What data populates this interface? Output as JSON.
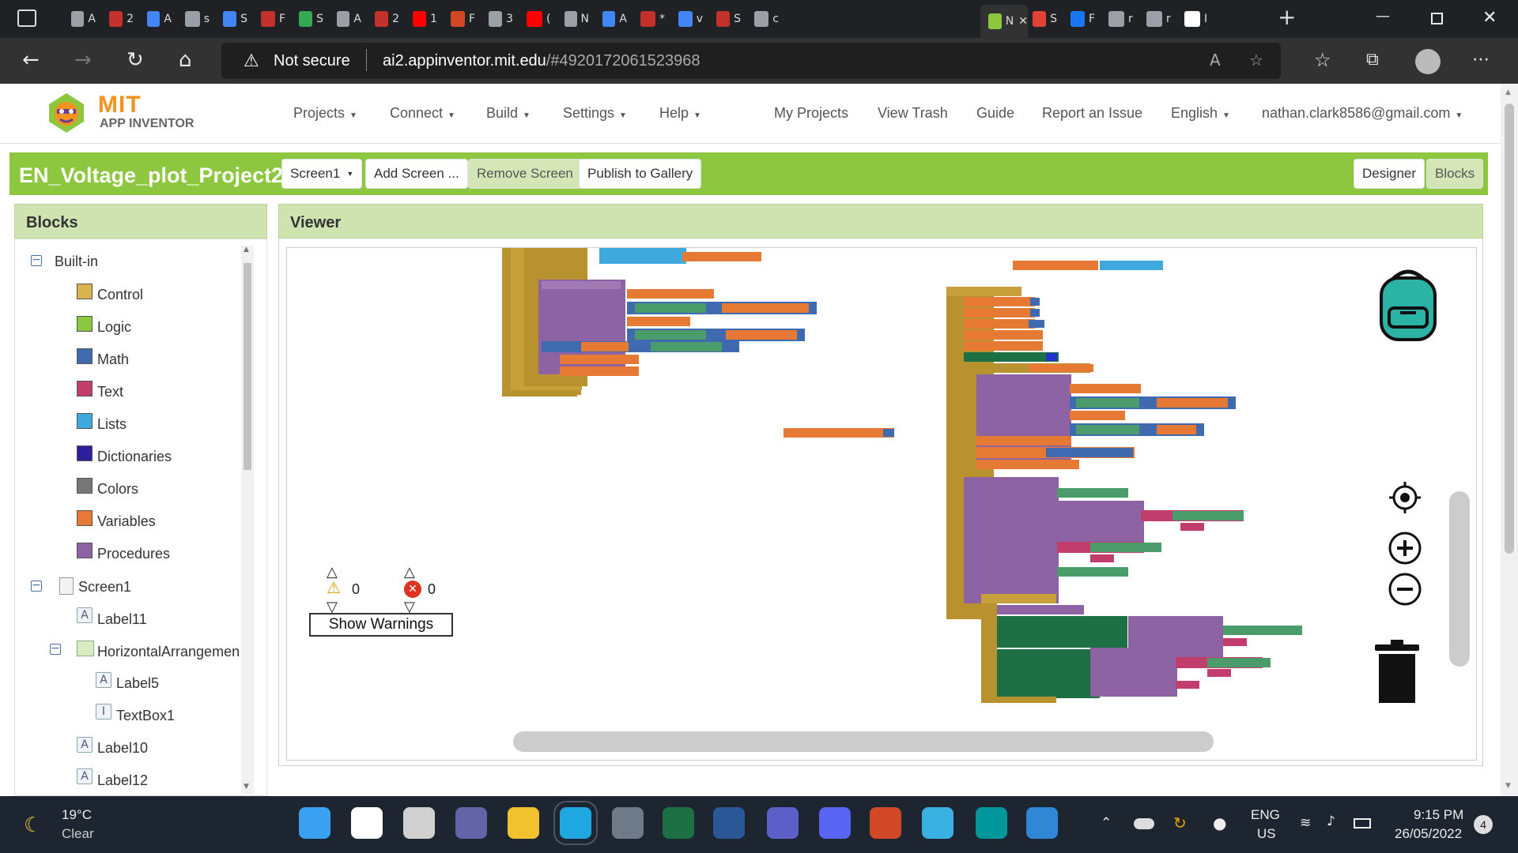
{
  "browser": {
    "tabs": [
      {
        "icon": "settings-icon",
        "color": "#9aa0a6",
        "title": "A"
      },
      {
        "icon": "pdf-icon",
        "color": "#c4312b",
        "title": "2"
      },
      {
        "icon": "docs-icon",
        "color": "#4285f4",
        "title": "A"
      },
      {
        "icon": "google-icon",
        "color": "#9aa0a6",
        "title": "s"
      },
      {
        "icon": "docs-icon",
        "color": "#4285f4",
        "title": "S"
      },
      {
        "icon": "pdf-icon",
        "color": "#c4312b",
        "title": "F"
      },
      {
        "icon": "drive-icon",
        "color": "#34a853",
        "title": "S"
      },
      {
        "icon": "file-icon",
        "color": "#9aa0a6",
        "title": "A"
      },
      {
        "icon": "pdf-icon",
        "color": "#c4312b",
        "title": "2"
      },
      {
        "icon": "youtube-icon",
        "color": "#ff0000",
        "title": "1"
      },
      {
        "icon": "powerpoint-icon",
        "color": "#d24726",
        "title": "F"
      },
      {
        "icon": "google-icon",
        "color": "#9aa0a6",
        "title": "3"
      },
      {
        "icon": "youtube-icon",
        "color": "#ff0000",
        "title": "("
      },
      {
        "icon": "window-icon",
        "color": "#9aa0a6",
        "title": "N"
      },
      {
        "icon": "docs-icon",
        "color": "#4285f4",
        "title": "A"
      },
      {
        "icon": "pdf-icon",
        "color": "#c4312b",
        "title": "*"
      },
      {
        "icon": "search-icon",
        "color": "#4285f4",
        "title": "v"
      },
      {
        "icon": "pdf-icon",
        "color": "#c4312b",
        "title": "S"
      },
      {
        "icon": "google-icon",
        "color": "#9aa0a6",
        "title": "c"
      },
      {
        "icon": "appinventor-icon",
        "color": "#8dc63f",
        "title": "N"
      },
      {
        "icon": "photo-icon",
        "color": "#e34133",
        "title": "S"
      },
      {
        "icon": "facebook-icon",
        "color": "#1877f2",
        "title": "F"
      },
      {
        "icon": "google-icon",
        "color": "#9aa0a6",
        "title": "r"
      },
      {
        "icon": "github-icon",
        "color": "#9aa0a6",
        "title": "r"
      },
      {
        "icon": "google-icon",
        "color": "#ffffff",
        "title": "I"
      }
    ],
    "not_secure": "Not secure",
    "url_domain": "ai2.appinventor.mit.edu",
    "url_rest": "/#4920172061523968"
  },
  "header": {
    "logo_line1": "MIT",
    "logo_line2": "APP INVENTOR",
    "menus": [
      "Projects",
      "Connect",
      "Build",
      "Settings",
      "Help"
    ],
    "links": [
      "My Projects",
      "View Trash",
      "Guide",
      "Report an Issue"
    ],
    "language": "English",
    "account": "nathan.clark8586@gmail.com"
  },
  "toolbar": {
    "project_name": "EN_Voltage_plot_Project2",
    "screen": "Screen1",
    "add_screen": "Add Screen ...",
    "remove_screen": "Remove Screen",
    "publish": "Publish to Gallery",
    "designer": "Designer",
    "blocks": "Blocks"
  },
  "blocks_panel": {
    "title": "Blocks",
    "builtin": "Built-in",
    "categories": [
      {
        "label": "Control",
        "color": "#d9b34f"
      },
      {
        "label": "Logic",
        "color": "#8dc63f"
      },
      {
        "label": "Math",
        "color": "#3f6ab0"
      },
      {
        "label": "Text",
        "color": "#c13d6c"
      },
      {
        "label": "Lists",
        "color": "#3fa8dc"
      },
      {
        "label": "Dictionaries",
        "color": "#2d1f99"
      },
      {
        "label": "Colors",
        "color": "#777777"
      },
      {
        "label": "Variables",
        "color": "#e67a35"
      },
      {
        "label": "Procedures",
        "color": "#8e63a3"
      }
    ],
    "screen": "Screen1",
    "components": [
      "Label11",
      "HorizontalArrangemen",
      "Label5",
      "TextBox1",
      "Label10",
      "Label12"
    ]
  },
  "viewer": {
    "title": "Viewer",
    "warning_count": "0",
    "error_count": "0",
    "show_warnings": "Show Warnings"
  },
  "taskbar": {
    "temperature": "19°C",
    "weather": "Clear",
    "lang1": "ENG",
    "lang2": "US",
    "time": "9:15 PM",
    "date": "26/05/2022",
    "notification_count": "4",
    "apps": [
      {
        "name": "start-icon",
        "color": "#3aa0f0"
      },
      {
        "name": "search-icon",
        "color": "#ffffff"
      },
      {
        "name": "task-view-icon",
        "color": "#d0d0d0"
      },
      {
        "name": "chat-icon",
        "color": "#6264a7"
      },
      {
        "name": "file-explorer-icon",
        "color": "#f2c12e"
      },
      {
        "name": "edge-icon",
        "color": "#1fa7e0"
      },
      {
        "name": "calculator-icon",
        "color": "#6e7a87"
      },
      {
        "name": "excel-icon",
        "color": "#1d7044"
      },
      {
        "name": "word-icon",
        "color": "#2b5797"
      },
      {
        "name": "teams-icon",
        "color": "#5b5fc7"
      },
      {
        "name": "discord-icon",
        "color": "#5865f2"
      },
      {
        "name": "powerpoint-icon",
        "color": "#d24726"
      },
      {
        "name": "paint-icon",
        "color": "#3ab0e0"
      },
      {
        "name": "arduino-icon",
        "color": "#00979c"
      },
      {
        "name": "photos-icon",
        "color": "#2f87d6"
      }
    ]
  }
}
